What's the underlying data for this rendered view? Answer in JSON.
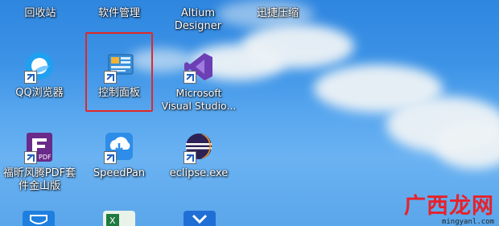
{
  "top_labels": [
    "回收站",
    "软件管理",
    "Altium Designer",
    "迅捷压缩"
  ],
  "icons": {
    "qq_browser": "QQ浏览器",
    "control_panel": "控制面板",
    "visual_studio": "Microsoft Visual Studio...",
    "foxit_pdf": "福昕风腾PDF套件金山版",
    "speedpan": "SpeedPan",
    "eclipse": "eclipse.exe"
  },
  "watermark": {
    "text": "广西龙网",
    "url": "mingyanl.com"
  }
}
